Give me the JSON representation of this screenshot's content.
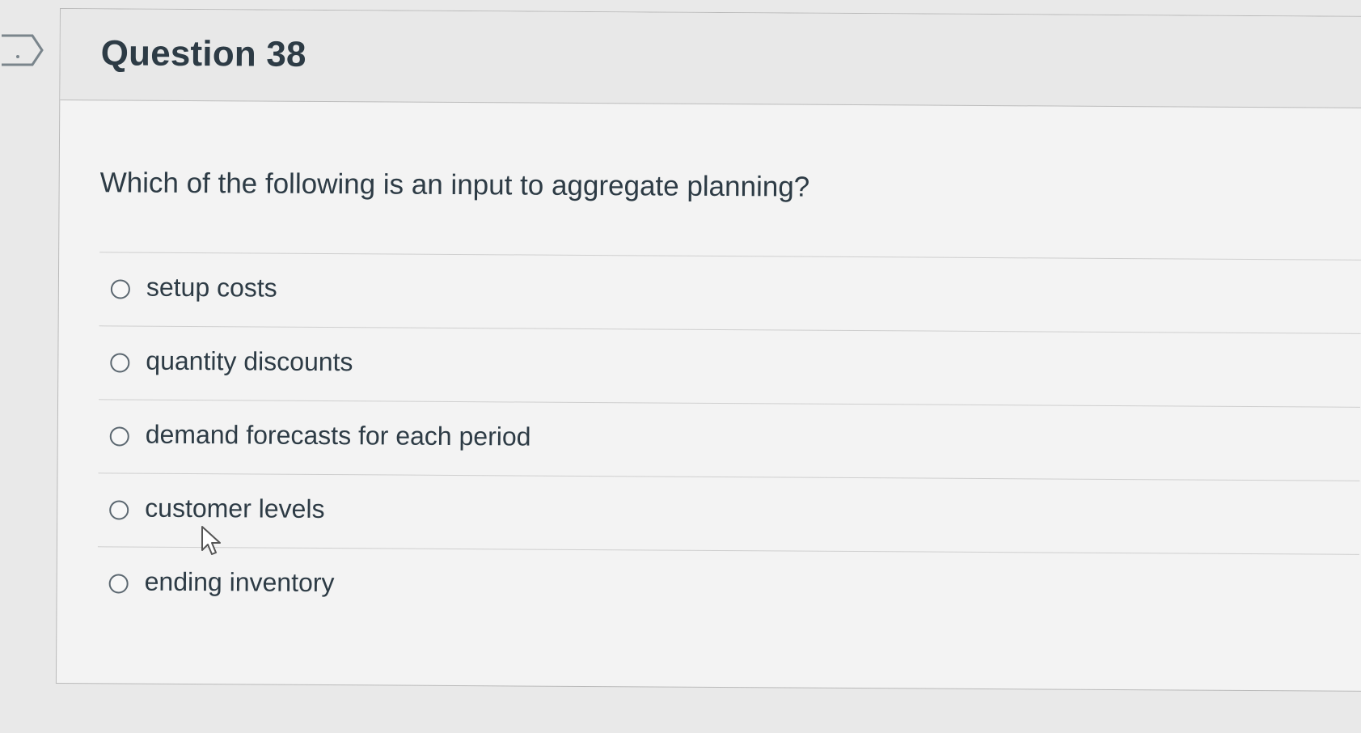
{
  "question": {
    "title": "Question 38",
    "text": "Which of the following is an input to aggregate planning?",
    "answers": [
      {
        "label": "setup costs",
        "selected": false
      },
      {
        "label": "quantity discounts",
        "selected": false
      },
      {
        "label": "demand forecasts for each period",
        "selected": false
      },
      {
        "label": "customer levels",
        "selected": false
      },
      {
        "label": "ending inventory",
        "selected": false
      }
    ]
  },
  "icons": {
    "flag": "flag-question-icon",
    "cursor": "mouse-pointer-icon"
  },
  "colors": {
    "text": "#2d3b45",
    "card_background": "#f3f3f3",
    "header_background": "#e8e8e8"
  }
}
